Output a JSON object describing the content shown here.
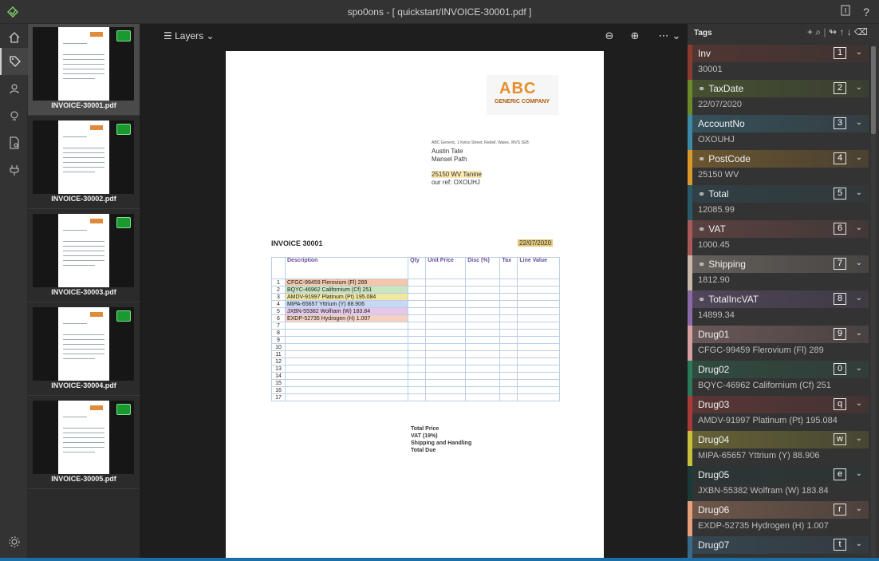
{
  "window": {
    "title": "spo0ons - [ quickstart/INVOICE-30001.pdf ]"
  },
  "rail": {
    "items": [
      "home-icon",
      "tag-icon",
      "connections-icon",
      "lightbulb-icon",
      "document-settings-icon",
      "plug-icon",
      "settings-icon"
    ]
  },
  "thumbnails": [
    {
      "name": "INVOICE-30001.pdf",
      "active": true
    },
    {
      "name": "INVOICE-30002.pdf",
      "active": false
    },
    {
      "name": "INVOICE-30003.pdf",
      "active": false
    },
    {
      "name": "INVOICE-30004.pdf",
      "active": false
    },
    {
      "name": "INVOICE-30005.pdf",
      "active": false
    }
  ],
  "canvas": {
    "layers_label": "Layers"
  },
  "document": {
    "logo_main": "ABC",
    "logo_sub": "GENERIC COMPANY",
    "address_line": "ABC Generic, 1 Kelso Street, Redell, Wales, WVS 1EB",
    "recipient_name": "Austin Tate",
    "recipient_addr": "Mansel Path",
    "postcode_line": "25150 WV Tanine",
    "ref_line": "our ref: OXOUHJ",
    "invoice_title": "INVOICE 30001",
    "invoice_date": "22/07/2020",
    "columns": [
      "",
      "Description",
      "Qty",
      "Unit Price",
      "Disc (%)",
      "Tax",
      "Line Value"
    ],
    "rows": [
      [
        "1",
        "CFGC-99459 Flerovium (Fl) 289",
        "",
        "",
        "",
        "",
        ""
      ],
      [
        "2",
        "BQYC-46962 Californium (Cf) 251",
        "",
        "",
        "",
        "",
        ""
      ],
      [
        "3",
        "AMDV-91997 Platinum (Pt) 195.084",
        "",
        "",
        "",
        "",
        ""
      ],
      [
        "4",
        "MIPA-65657 Yttrium (Y) 88.906",
        "",
        "",
        "",
        "",
        ""
      ],
      [
        "5",
        "JXBN-55382 Wolfram (W) 183.84",
        "",
        "",
        "",
        "",
        ""
      ],
      [
        "6",
        "EXDP-52735 Hydrogen (H) 1.007",
        "",
        "",
        "",
        "",
        ""
      ],
      [
        "7",
        "",
        "",
        "",
        "",
        "",
        ""
      ],
      [
        "8",
        "",
        "",
        "",
        "",
        "",
        ""
      ],
      [
        "9",
        "",
        "",
        "",
        "",
        "",
        ""
      ],
      [
        "10",
        "",
        "",
        "",
        "",
        "",
        ""
      ],
      [
        "11",
        "",
        "",
        "",
        "",
        "",
        ""
      ],
      [
        "12",
        "",
        "",
        "",
        "",
        "",
        ""
      ],
      [
        "13",
        "",
        "",
        "",
        "",
        "",
        ""
      ],
      [
        "14",
        "",
        "",
        "",
        "",
        "",
        ""
      ],
      [
        "15",
        "",
        "",
        "",
        "",
        "",
        ""
      ],
      [
        "16",
        "",
        "",
        "",
        "",
        "",
        ""
      ],
      [
        "17",
        "",
        "",
        "",
        "",
        "",
        ""
      ]
    ],
    "totals": [
      "Total Price",
      "VAT (19%)",
      "Shipping and Handling",
      "Total Due"
    ]
  },
  "tags_panel": {
    "header": "Tags",
    "tags": [
      {
        "name": "Inv",
        "key": "1",
        "value": "30001",
        "color": "#8a3b2f",
        "linked": false
      },
      {
        "name": "TaxDate",
        "key": "2",
        "value": "22/07/2020",
        "color": "#6a8a2a",
        "linked": true
      },
      {
        "name": "AccountNo",
        "key": "3",
        "value": "OXOUHJ",
        "color": "#3a8aa8",
        "linked": false
      },
      {
        "name": "PostCode",
        "key": "4",
        "value": "25150 WV",
        "color": "#d89a2a",
        "linked": true
      },
      {
        "name": "Total",
        "key": "5",
        "value": "12085.99",
        "color": "#2a5a6a",
        "linked": true
      },
      {
        "name": "VAT",
        "key": "6",
        "value": "1000.45",
        "color": "#a85a5a",
        "linked": true
      },
      {
        "name": "Shipping",
        "key": "7",
        "value": "1812.90",
        "color": "#c8b8a8",
        "linked": true
      },
      {
        "name": "TotalIncVAT",
        "key": "8",
        "value": "14899.34",
        "color": "#8a6aa8",
        "linked": true
      },
      {
        "name": "Drug01",
        "key": "9",
        "value": "CFGC-99459 Flerovium (Fl) 289",
        "color": "#d8a0a0",
        "linked": false
      },
      {
        "name": "Drug02",
        "key": "0",
        "value": "BQYC-46962 Californium (Cf) 251",
        "color": "#2a7a5a",
        "linked": false
      },
      {
        "name": "Drug03",
        "key": "q",
        "value": "AMDV-91997 Platinum (Pt) 195.084",
        "color": "#a83a3a",
        "linked": false
      },
      {
        "name": "Drug04",
        "key": "w",
        "value": "MIPA-65657 Yttrium (Y) 88.906",
        "color": "#c8c03a",
        "linked": false
      },
      {
        "name": "Drug05",
        "key": "e",
        "value": "JXBN-55382 Wolfram (W) 183.84",
        "color": "#1a3a3a",
        "linked": false
      },
      {
        "name": "Drug06",
        "key": "r",
        "value": "EXDP-52735 Hydrogen (H) 1.007",
        "color": "#e8a07a",
        "linked": false
      },
      {
        "name": "Drug07",
        "key": "t",
        "value": "",
        "color": "#3a6a8a",
        "linked": false
      }
    ]
  }
}
